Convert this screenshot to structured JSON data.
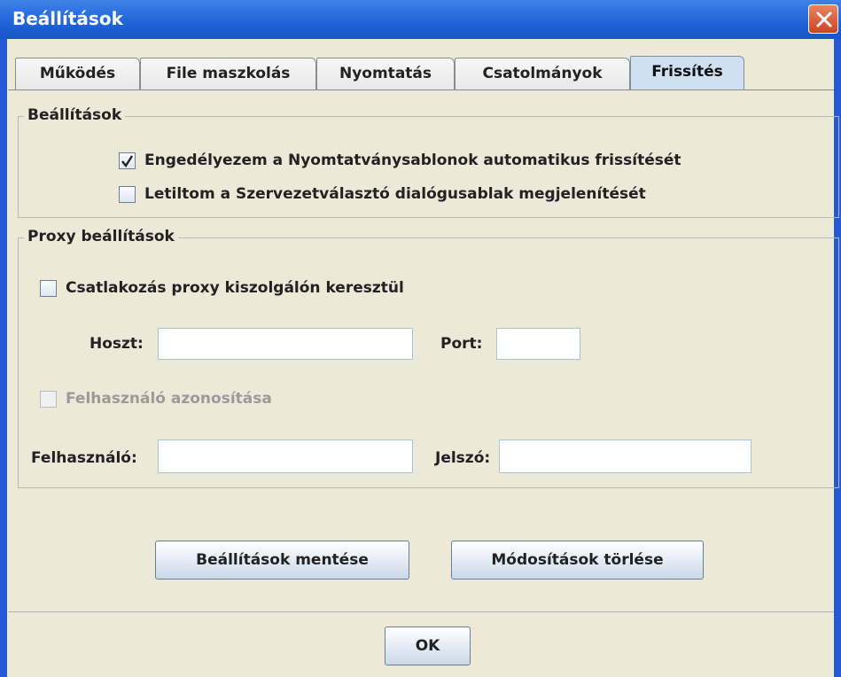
{
  "window": {
    "title": "Beállítások"
  },
  "tabs": [
    "Működés",
    "File maszkolás",
    "Nyomtatás",
    "Csatolmányok",
    "Frissítés"
  ],
  "active_tab": "Frissítés",
  "settings_group": {
    "legend": "Beállítások",
    "auto_update": {
      "label": "Engedélyezem a Nyomtatványsablonok automatikus frissítését",
      "checked": true
    },
    "disable_org_dialog": {
      "label": "Letiltom a Szervezetválasztó dialógusablak megjelenítését",
      "checked": false
    }
  },
  "proxy_group": {
    "legend": "Proxy beállítások",
    "use_proxy": {
      "label": "Csatlakozás proxy kiszolgálón keresztül",
      "checked": false
    },
    "host_label": "Hoszt:",
    "host_value": "",
    "port_label": "Port:",
    "port_value": "",
    "auth": {
      "label": "Felhasználó azonosítása",
      "checked": false,
      "enabled": false
    },
    "user_label": "Felhasználó:",
    "user_value": "",
    "password_label": "Jelszó:",
    "password_value": ""
  },
  "buttons": {
    "save": "Beállítások mentése",
    "discard": "Módosítások törlése",
    "ok": "OK"
  },
  "colors": {
    "title_bar": "#2b6fe0",
    "active_tab": "#cfe0f3",
    "background": "#ece9d8",
    "close_button": "#d95a32"
  }
}
